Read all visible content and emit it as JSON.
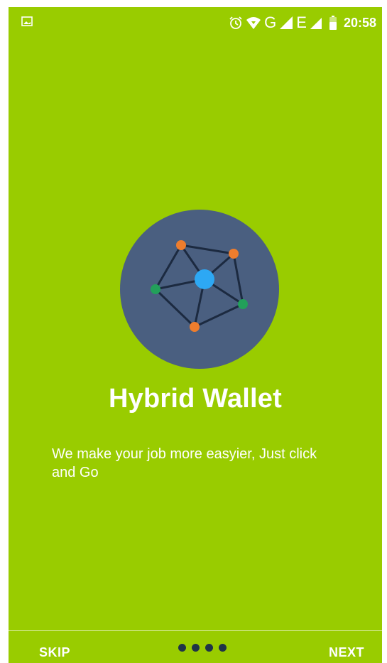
{
  "status_bar": {
    "left_icon": "image-icon",
    "icons": [
      "alarm-icon",
      "wifi-icon",
      "signal-icon"
    ],
    "carrier_g": "G",
    "carrier_e": "E",
    "battery_icon": "battery-icon",
    "time": "20:58"
  },
  "hero": {
    "icon": "network-nodes-icon",
    "circle_color": "#4a5f80",
    "node_colors": {
      "orange": "#ee7d2d",
      "green": "#22a05a",
      "blue": "#2da8f4"
    }
  },
  "content": {
    "title": "Hybrid Wallet",
    "description": "We make your job more easyier, Just click and Go"
  },
  "bottom_bar": {
    "skip_label": "SKIP",
    "next_label": "NEXT",
    "page_indicator_count": 4
  },
  "colors": {
    "background": "#99cc00",
    "text": "#ffffff",
    "dots": "#1f3448"
  }
}
